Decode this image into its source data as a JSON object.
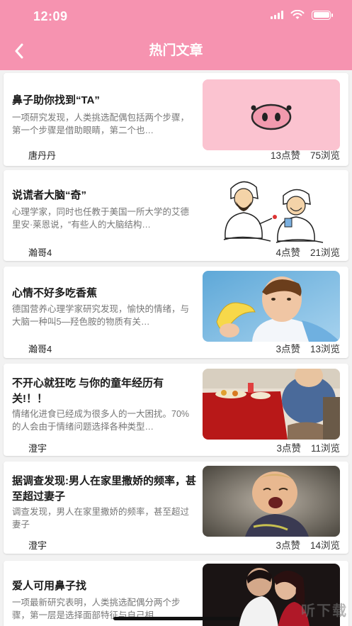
{
  "status": {
    "time": "12:09"
  },
  "header": {
    "title": "热门文章"
  },
  "articles": [
    {
      "title": "鼻子助你找到“TA”",
      "desc": "一项研究发现，人类挑选配偶包括两个步骤，第一个步骤是借助眼睛，第二个也…",
      "author": "唐丹丹",
      "likes": "13点赞",
      "views": "75浏览",
      "image": "pig-nose"
    },
    {
      "title": "说谎者大脑“奇”",
      "desc": "心理学家，同时也任教于美国一所大学的艾德里安·莱恩说，“有些人的大脑结构…",
      "author": "瀚哥4",
      "likes": "4点赞",
      "views": "21浏览",
      "image": "cartoon-liars"
    },
    {
      "title": "心情不好多吃香蕉",
      "desc": "德国营养心理学家研究发现，愉快的情绪，与大脑一种叫5—羟色胺的物质有关…",
      "author": "瀚哥4",
      "likes": "3点赞",
      "views": "13浏览",
      "image": "boy-banana"
    },
    {
      "title": "不开心就狂吃 与你的童年经历有关!！！",
      "desc": "情绪化进食已经成为很多人的一大困扰。70%的人会由于情绪问题选择各种类型…",
      "author": "澄宇",
      "likes": "3点赞",
      "views": "11浏览",
      "image": "eating-table"
    },
    {
      "title": "据调查发现:男人在家里撒娇的频率，甚至超过妻子",
      "desc": "调查发现，男人在家里撒娇的频率，甚至超过妻子",
      "author": "澄宇",
      "likes": "3点赞",
      "views": "14浏览",
      "image": "crying-child"
    },
    {
      "title": "爱人可用鼻子找",
      "desc": "一项最新研究表明，人类挑选配偶分两个步骤，第一层是选择面部特征与自己相…",
      "author": "",
      "likes": "",
      "views": "",
      "image": "couple"
    }
  ],
  "watermark": "听下载",
  "colors": {
    "header": "#f693b0",
    "background": "#f2f2f2"
  }
}
